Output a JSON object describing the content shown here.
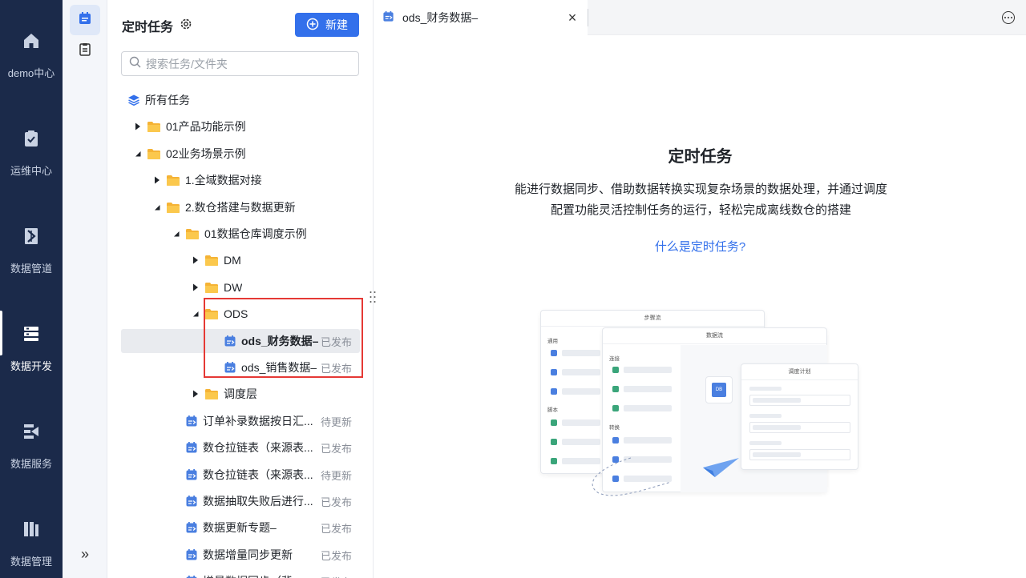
{
  "nav": {
    "items": [
      {
        "label": "demo中心",
        "icon": "home-icon"
      },
      {
        "label": "运维中心",
        "icon": "clipboard-check-icon"
      },
      {
        "label": "数据管道",
        "icon": "pipeline-icon"
      },
      {
        "label": "数据开发",
        "icon": "data-dev-icon"
      },
      {
        "label": "数据服务",
        "icon": "data-service-icon"
      },
      {
        "label": "数据管理",
        "icon": "data-manage-icon"
      }
    ],
    "active": "数据开发"
  },
  "rail": {
    "expand_glyph": "»"
  },
  "panel": {
    "title": "定时任务",
    "new_button": "新建",
    "search_placeholder": "搜索任务/文件夹",
    "tree": [
      {
        "label": "所有任务",
        "level": 0,
        "type": "root"
      },
      {
        "label": "01产品功能示例",
        "level": 1,
        "type": "folder",
        "expanded": false
      },
      {
        "label": "02业务场景示例",
        "level": 1,
        "type": "folder",
        "expanded": true
      },
      {
        "label": "1.全域数据对接",
        "level": 2,
        "type": "folder",
        "expanded": false
      },
      {
        "label": "2.数仓搭建与数据更新",
        "level": 2,
        "type": "folder",
        "expanded": true
      },
      {
        "label": "01数据仓库调度示例",
        "level": 3,
        "type": "folder",
        "expanded": true
      },
      {
        "label": "DM",
        "level": 4,
        "type": "folder",
        "expanded": false
      },
      {
        "label": "DW",
        "level": 4,
        "type": "folder",
        "expanded": false
      },
      {
        "label": "ODS",
        "level": 4,
        "type": "folder",
        "expanded": true
      },
      {
        "label": "ods_财务数据–",
        "level": 5,
        "type": "task",
        "status": "已发布",
        "selected": true
      },
      {
        "label": "ods_销售数据–",
        "level": 5,
        "type": "task",
        "status": "已发布"
      },
      {
        "label": "调度层",
        "level": 4,
        "type": "folder",
        "expanded": false
      },
      {
        "label": "订单补录数据按日汇...",
        "level": 3,
        "type": "task",
        "status": "待更新"
      },
      {
        "label": "数仓拉链表（来源表...",
        "level": 3,
        "type": "task",
        "status": "已发布"
      },
      {
        "label": "数仓拉链表（来源表...",
        "level": 3,
        "type": "task",
        "status": "待更新"
      },
      {
        "label": "数据抽取失败后进行...",
        "level": 3,
        "type": "task",
        "status": "已发布"
      },
      {
        "label": "数据更新专题–",
        "level": 3,
        "type": "task",
        "status": "已发布"
      },
      {
        "label": "数据增量同步更新",
        "level": 3,
        "type": "task",
        "status": "已发布"
      },
      {
        "label": "增量数据同步（背...",
        "level": 3,
        "type": "task",
        "status": "已发布"
      }
    ]
  },
  "tab": {
    "label": "ods_财务数据–",
    "close_glyph": "×"
  },
  "content": {
    "title": "定时任务",
    "description": "能进行数据同步、借助数据转换实现复杂场景的数据处理，并通过调度配置功能灵活控制任务的运行，轻松完成离线数仓的搭建",
    "link": "什么是定时任务?",
    "illustration": {
      "card1_title": "步骤流",
      "card1_section1": "通用",
      "card1_section2": "脚本",
      "card2_title": "数据流",
      "card2_section1": "连接",
      "card2_section2": "转换",
      "card3_title": "调度计划",
      "node_label": "DB"
    }
  },
  "colors": {
    "nav_bg": "#1b2a4a",
    "accent": "#3370eb",
    "folder": "#f5b335",
    "highlight_box": "#e53935"
  }
}
